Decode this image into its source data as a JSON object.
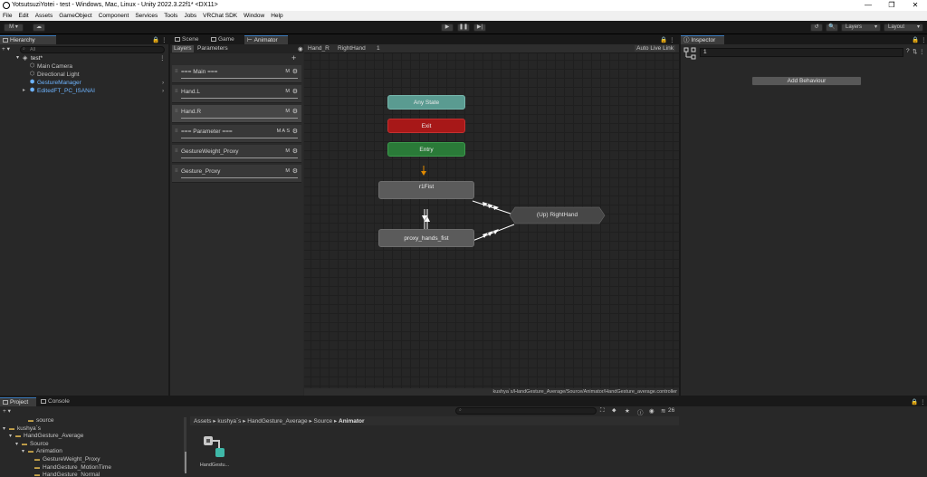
{
  "window": {
    "title": "YotsutsuziYotei - test - Windows, Mac, Linux - Unity 2022.3.22f1* <DX11>",
    "controls": [
      "—",
      "❐",
      "✕"
    ]
  },
  "menu": [
    "File",
    "Edit",
    "Assets",
    "GameObject",
    "Component",
    "Services",
    "Tools",
    "Jobs",
    "VRChat SDK",
    "Window",
    "Help"
  ],
  "toolbar": {
    "account": "M ▾",
    "cloud": "☁",
    "play": "▶",
    "pause": "❚❚",
    "step": "▶|",
    "history": "↺",
    "search": "🔍",
    "layers": "Layers",
    "layout": "Layout"
  },
  "hierarchy": {
    "tab": "Hierarchy",
    "add": "+ ▾",
    "search_placeholder": "All",
    "scene": "test*",
    "items": [
      {
        "label": "Main Camera",
        "kind": "camera"
      },
      {
        "label": "Directional Light",
        "kind": "light"
      },
      {
        "label": "GestureManager",
        "kind": "prefab"
      },
      {
        "label": "EditedFT_PC_ISANAI",
        "kind": "prefab"
      }
    ]
  },
  "tabs": {
    "scene": "Scene",
    "game": "Game",
    "animator": "Animator"
  },
  "animator": {
    "subtabs": {
      "layers": "Layers",
      "parameters": "Parameters"
    },
    "add": "+",
    "layers": [
      {
        "name": "=== Main ===",
        "flags": "M"
      },
      {
        "name": "Hand.L",
        "flags": "M"
      },
      {
        "name": "Hand.R",
        "flags": "M"
      },
      {
        "name": "=== Parameter ===",
        "flags": "M A S"
      },
      {
        "name": "GestureWeight_Proxy",
        "flags": "M"
      },
      {
        "name": "Gesture_Proxy",
        "flags": "M"
      }
    ],
    "gear": "⚙",
    "breadcrumb": [
      "Hand_R",
      "RightHand",
      "1"
    ],
    "auto_live_link": "Auto Live Link",
    "nodes": {
      "any_state": "Any State",
      "exit": "Exit",
      "entry": "Entry",
      "r1fist": "r1Fist",
      "proxy": "proxy_hands_fist",
      "up": "(Up) RightHand"
    },
    "footer_path": "kushya`s/HandGesture_Average/Source/Animator/HandGesture_average.controller",
    "colors": {
      "any_state": "#5a9b91",
      "exit": "#a71818",
      "entry": "#2a7a38",
      "state": "#5b5b5b",
      "grid": "#262626"
    }
  },
  "inspector": {
    "tab": "Inspector",
    "name_value": "1",
    "add_behaviour": "Add Behaviour"
  },
  "project": {
    "tabs": {
      "project": "Project",
      "console": "Console"
    },
    "add": "+ ▾",
    "tree": [
      {
        "label": "source",
        "depth": 3
      },
      {
        "label": "kushya`s",
        "depth": 0
      },
      {
        "label": "HandGesture_Average",
        "depth": 1
      },
      {
        "label": "Source",
        "depth": 2
      },
      {
        "label": "Animation",
        "depth": 3
      },
      {
        "label": "GestureWeight_Proxy",
        "depth": 4
      },
      {
        "label": "HandGesture_MotionTime",
        "depth": 4
      },
      {
        "label": "HandGesture_Normal",
        "depth": 4
      }
    ],
    "breadcrumb": [
      "Assets",
      "kushya`s",
      "HandGesture_Average",
      "Source",
      "Animator"
    ],
    "count": "26",
    "asset": "HandGestu..."
  }
}
